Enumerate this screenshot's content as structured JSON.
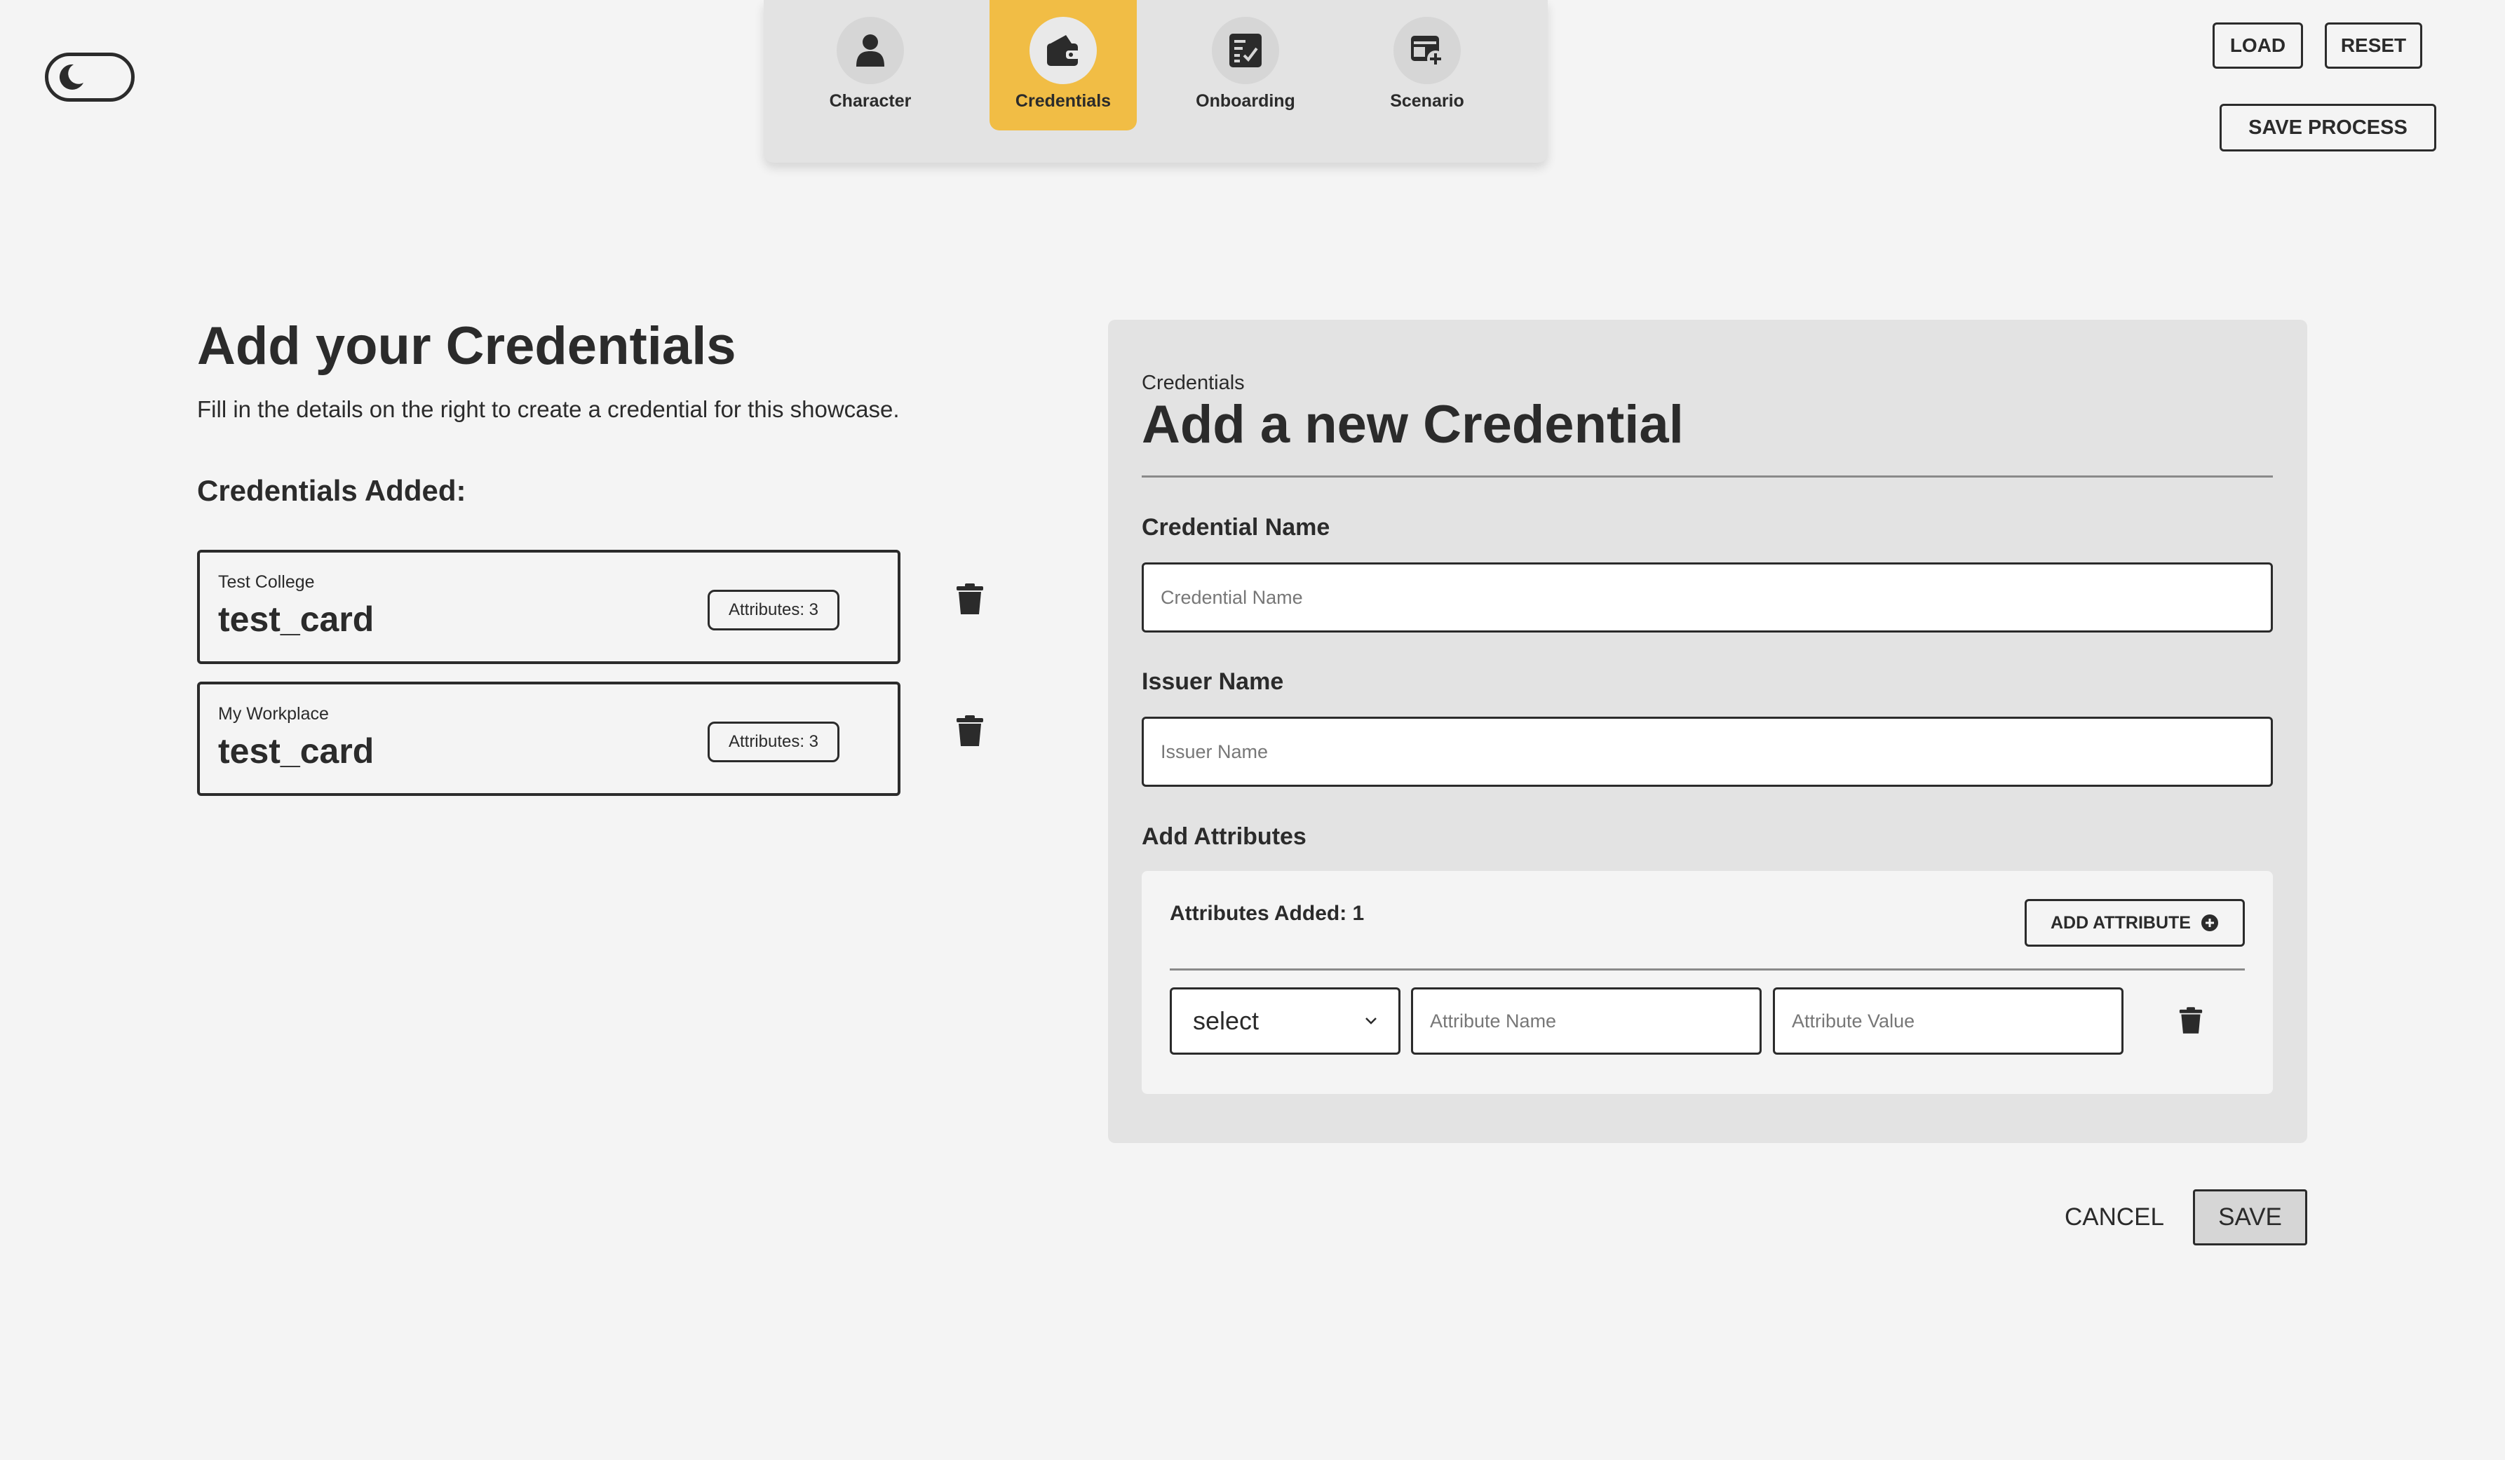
{
  "colors": {
    "background": "#f4f4f4",
    "panel": "#e3e3e3",
    "accent": "#f1bd45",
    "text": "#2b2b2b"
  },
  "theme_toggle": {
    "icon": "moon-icon"
  },
  "stepper": {
    "steps": [
      {
        "label": "Character",
        "icon": "person-icon",
        "active": false
      },
      {
        "label": "Credentials",
        "icon": "wallet-icon",
        "active": true
      },
      {
        "label": "Onboarding",
        "icon": "checklist-icon",
        "active": false
      },
      {
        "label": "Scenario",
        "icon": "add-window-icon",
        "active": false
      }
    ]
  },
  "top_actions": {
    "load": "LOAD",
    "reset": "RESET",
    "save_process": "SAVE PROCESS"
  },
  "left": {
    "title": "Add your Credentials",
    "subtitle": "Fill in the details on the right to create a credential for this showcase.",
    "added_heading": "Credentials Added:",
    "credentials": [
      {
        "issuer": "Test College",
        "name": "test_card",
        "badge": "Attributes: 3"
      },
      {
        "issuer": "My Workplace",
        "name": "test_card",
        "badge": "Attributes: 3"
      }
    ]
  },
  "form": {
    "eyebrow": "Credentials",
    "title": "Add a new Credential",
    "credential_name_label": "Credential Name",
    "credential_name_placeholder": "Credential Name",
    "issuer_name_label": "Issuer Name",
    "issuer_name_placeholder": "Issuer Name",
    "attributes_label": "Add Attributes",
    "attributes_count": "Attributes Added: 1",
    "add_attribute_button": "ADD ATTRIBUTE",
    "attribute_row": {
      "type_value": "select",
      "name_placeholder": "Attribute Name",
      "value_placeholder": "Attribute Value"
    }
  },
  "footer": {
    "cancel": "CANCEL",
    "save": "SAVE"
  }
}
